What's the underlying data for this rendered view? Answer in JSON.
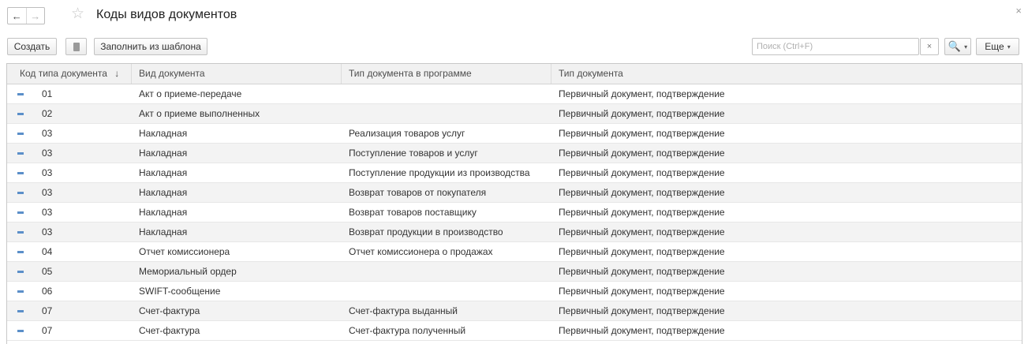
{
  "window": {
    "title": "Коды видов документов",
    "back_icon": "←",
    "forward_icon": "→",
    "star_icon": "☆",
    "close_icon": "×"
  },
  "toolbar": {
    "create_label": "Создать",
    "fill_label": "Заполнить из шаблона",
    "search_placeholder": "Поиск (Ctrl+F)",
    "clear_icon": "×",
    "search_icon": "🔍",
    "more_label": "Еще",
    "dropdown_icon": "▾"
  },
  "table": {
    "columns": [
      "Код типа документа",
      "Вид документа",
      "Тип документа в программе",
      "Тип документа"
    ],
    "sort_icon": "↓",
    "rows": [
      {
        "code": "01",
        "kind": "Акт о приеме-передаче",
        "program_type": "",
        "doc_type": "Первичный документ, подтверждение"
      },
      {
        "code": "02",
        "kind": "Акт о приеме выполненных",
        "program_type": "",
        "doc_type": "Первичный документ, подтверждение"
      },
      {
        "code": "03",
        "kind": "Накладная",
        "program_type": "Реализация товаров услуг",
        "doc_type": "Первичный документ, подтверждение"
      },
      {
        "code": "03",
        "kind": "Накладная",
        "program_type": "Поступление товаров и услуг",
        "doc_type": "Первичный документ, подтверждение"
      },
      {
        "code": "03",
        "kind": "Накладная",
        "program_type": "Поступление продукции из производства",
        "doc_type": "Первичный документ, подтверждение"
      },
      {
        "code": "03",
        "kind": "Накладная",
        "program_type": "Возврат товаров от покупателя",
        "doc_type": "Первичный документ, подтверждение"
      },
      {
        "code": "03",
        "kind": "Накладная",
        "program_type": "Возврат товаров поставщику",
        "doc_type": "Первичный документ, подтверждение"
      },
      {
        "code": "03",
        "kind": "Накладная",
        "program_type": "Возврат продукции в производство",
        "doc_type": "Первичный документ, подтверждение"
      },
      {
        "code": "04",
        "kind": "Отчет комиссионера",
        "program_type": "Отчет комиссионера о продажах",
        "doc_type": "Первичный документ, подтверждение"
      },
      {
        "code": "05",
        "kind": "Мемориальный ордер",
        "program_type": "",
        "doc_type": "Первичный документ, подтверждение"
      },
      {
        "code": "06",
        "kind": "SWIFT-сообщение",
        "program_type": "",
        "doc_type": "Первичный документ, подтверждение"
      },
      {
        "code": "07",
        "kind": "Счет-фактура",
        "program_type": "Счет-фактура выданный",
        "doc_type": "Первичный документ, подтверждение"
      },
      {
        "code": "07",
        "kind": "Счет-фактура",
        "program_type": "Счет-фактура полученный",
        "doc_type": "Первичный документ, подтверждение"
      }
    ]
  },
  "colors": {
    "row_marker": "#5b8fc9",
    "accent": "#3d6ec9"
  }
}
